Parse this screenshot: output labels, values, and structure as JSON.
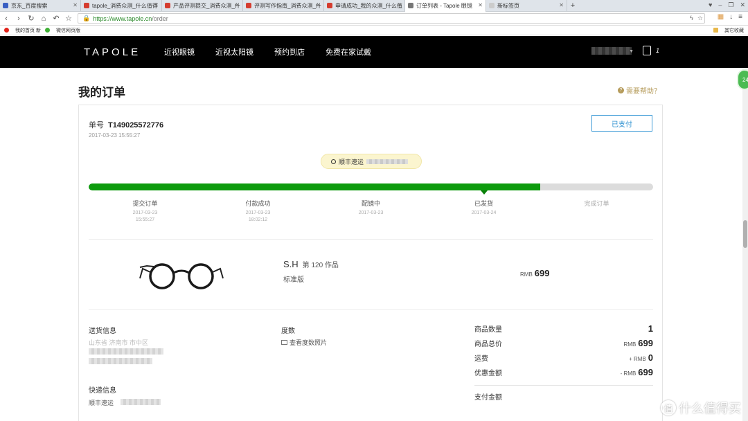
{
  "browser": {
    "tabs": [
      {
        "label": "京东_百度搜索",
        "favicon_color": "#3a5fc2"
      },
      {
        "label": "tapole_消费众测_什么值得",
        "favicon_color": "#d53c2f"
      },
      {
        "label": "产品评测提交_消费众测_什",
        "favicon_color": "#d53c2f"
      },
      {
        "label": "评测写作指南_消费众测_什",
        "favicon_color": "#d53c2f"
      },
      {
        "label": "申请成功_我的众测_什么值",
        "favicon_color": "#d53c2f"
      },
      {
        "label": "订单列表 - Tapole 眼镜",
        "favicon_color": "#777777",
        "active": true
      },
      {
        "label": "新标签页",
        "favicon_color": "#cccccc"
      }
    ],
    "new_tab": "+",
    "url_host": "https://www.tapole.cn",
    "url_path": "/order",
    "bookmarks": [
      {
        "label": "我的首页 新",
        "color": "#e2231a"
      },
      {
        "label": "微信网页版",
        "color": "#3fb035"
      }
    ],
    "bookmarks_other": "其它收藏"
  },
  "site": {
    "logo": "TAPOLE",
    "nav": [
      "近视眼镜",
      "近视太阳镜",
      "预约到店",
      "免费在家试戴"
    ],
    "cart_count": "1",
    "side_badge": "24"
  },
  "page": {
    "title": "我的订单",
    "help": "需要帮助？"
  },
  "order": {
    "number_label": "单号",
    "number": "T149025572776",
    "created": "2017-03-23 15:55:27",
    "status_button": "已支付",
    "tracking_label": "顺丰速运",
    "progress_fraction": 0.8,
    "steps": [
      {
        "name": "提交订单",
        "date": "2017-03-23",
        "time": "15:55:27",
        "done": true
      },
      {
        "name": "付款成功",
        "date": "2017-03-23",
        "time": "18:02:12",
        "done": true
      },
      {
        "name": "配镜中",
        "date": "2017-03-23",
        "time": "",
        "done": true
      },
      {
        "name": "已发货",
        "date": "2017-03-24",
        "time": "",
        "done": true
      },
      {
        "name": "完成订单",
        "date": "",
        "time": "",
        "done": false
      }
    ],
    "product": {
      "name": "S.H",
      "works": "第 120 作品",
      "version": "标准版",
      "currency": "RMB",
      "price": "699"
    },
    "shipping": {
      "label": "送货信息",
      "address": "山东省 济南市 市中区"
    },
    "prescription": {
      "label": "度数",
      "link": "查看度数照片"
    },
    "delivery": {
      "label": "快递信息",
      "carrier": "顺丰速运"
    },
    "summary": {
      "qty_label": "商品数量",
      "qty": "1",
      "total_label": "商品总价",
      "total_prefix": "RMB",
      "total": "699",
      "freight_label": "运费",
      "freight_prefix": "+ RMB",
      "freight": "0",
      "discount_label": "优惠金额",
      "discount_prefix": "- RMB",
      "discount": "699",
      "pay_label": "支付金额"
    }
  },
  "watermark": {
    "glyph": "值",
    "text": "什么值得买"
  }
}
